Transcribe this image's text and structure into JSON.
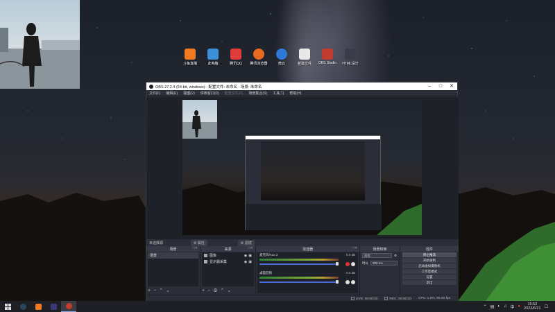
{
  "obs": {
    "title": "OBS 27.2.4 (64-bit, windows) - 配置文件: 未命名 - 场景: 未命名",
    "menu": [
      "文件(F)",
      "编辑(E)",
      "视图(V)",
      "停靠窗口(D)",
      "配置文件(P)",
      "场景集合(S)",
      "工具(T)",
      "帮助(H)"
    ],
    "menu_disabled": "配置文件(P)",
    "scene_label": "未选择源",
    "prop_button": "属性",
    "filter_button": "滤镜",
    "docks": {
      "scenes": {
        "title": "场景",
        "items": [
          "场景"
        ]
      },
      "sources": {
        "title": "来源",
        "items": [
          "图像",
          "显示器采集"
        ]
      },
      "mixer": {
        "title": "混音器",
        "channels": [
          {
            "name": "麦克风/Aux 2",
            "db": "0.0 dB"
          },
          {
            "name": "桌面音频",
            "db": "0.0 dB"
          }
        ]
      },
      "transitions": {
        "title": "场景转换",
        "type": "淡化",
        "duration_label": "时长",
        "duration_value": "300 ms"
      },
      "controls": {
        "title": "控件",
        "buttons": [
          "停止推流",
          "开始录制",
          "启动虚拟摄像机",
          "工作室模式",
          "设置",
          "退出"
        ]
      }
    },
    "status": {
      "live": "LIVE: 00:00:00",
      "rec": "REC: 00:00:00",
      "cpu": "CPU: 1.0%, 60.00 fps"
    }
  },
  "desktop_icons": [
    "斗鱼直播",
    "此电脑",
    "腾讯QQ",
    "腾讯浏览器",
    "微云",
    "新建文件",
    "OBS Studio",
    "HTML设计"
  ],
  "taskbar": {
    "time": "15:52",
    "date": "2022/6/21"
  },
  "colors": {
    "obs_bg": "#2b2e38",
    "dock_bg": "#1f2129",
    "accent_blue": "#4e6ad6",
    "taskbar": "#1d1f24"
  }
}
